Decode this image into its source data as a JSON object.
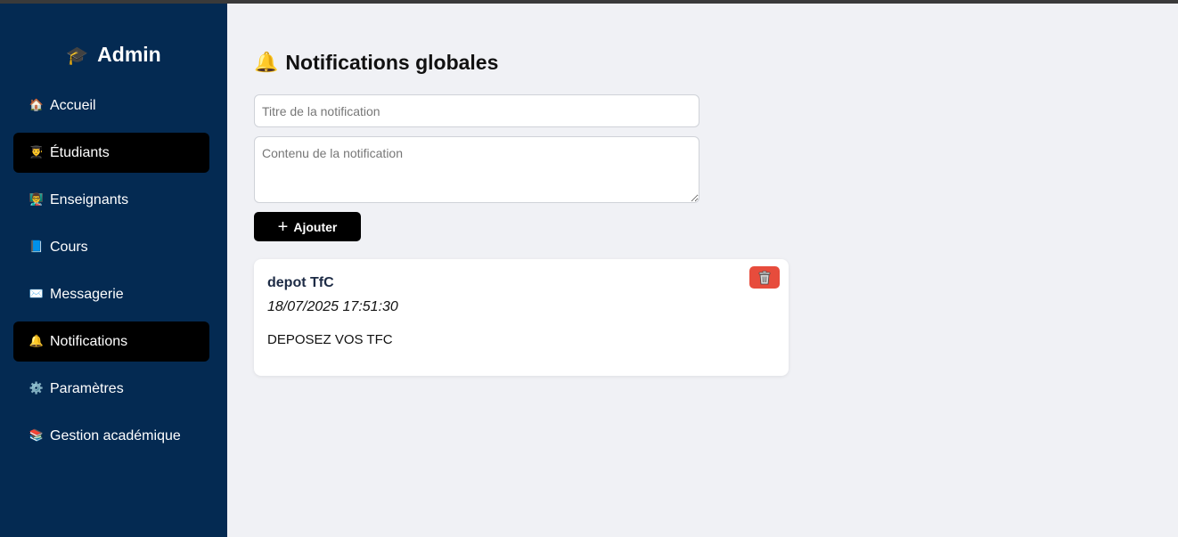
{
  "sidebar": {
    "brand": {
      "icon": "graduation-cap-icon",
      "glyph": "🎓",
      "title": "Admin"
    },
    "items": [
      {
        "label": "Accueil",
        "icon": "house-icon",
        "glyph": "🏠",
        "active": false
      },
      {
        "label": "Étudiants",
        "icon": "student-icon",
        "glyph": "👨‍🎓",
        "active": true
      },
      {
        "label": "Enseignants",
        "icon": "teacher-icon",
        "glyph": "👨‍🏫",
        "active": false
      },
      {
        "label": "Cours",
        "icon": "book-icon",
        "glyph": "📘",
        "active": false
      },
      {
        "label": "Messagerie",
        "icon": "envelope-icon",
        "glyph": "✉️",
        "active": false
      },
      {
        "label": "Notifications",
        "icon": "bell-icon",
        "glyph": "🔔",
        "active": true
      },
      {
        "label": "Paramètres",
        "icon": "gear-icon",
        "glyph": "⚙️",
        "active": false
      },
      {
        "label": "Gestion académique",
        "icon": "books-icon",
        "glyph": "📚",
        "active": false
      }
    ]
  },
  "main": {
    "title": "Notifications globales",
    "title_icon": "bell-icon",
    "title_glyph": "🔔",
    "form": {
      "title_placeholder": "Titre de la notification",
      "content_placeholder": "Contenu de la notification",
      "add_label": "Ajouter"
    },
    "notifications": [
      {
        "title": "depot TfC",
        "date": "18/07/2025 17:51:30",
        "content": "DEPOSEZ VOS TFC",
        "delete_icon": "trash-icon"
      }
    ]
  },
  "colors": {
    "sidebar_bg": "#042a52",
    "active_item_bg": "#000000",
    "page_bg": "#f0f1f5",
    "delete_button": "#e74c3c"
  }
}
